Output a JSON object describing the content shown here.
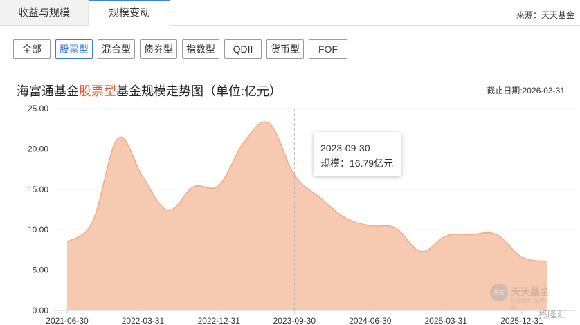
{
  "tabs": [
    {
      "label": "收益与规模"
    },
    {
      "label": "规模变动"
    }
  ],
  "source": "来源：天天基金",
  "filters": [
    "全部",
    "股票型",
    "混合型",
    "债券型",
    "指数型",
    "QDII",
    "货币型",
    "FOF"
  ],
  "active_filter": "股票型",
  "title_prefix": "海富通基金",
  "title_highlight": "股票型",
  "title_suffix": "基金规模走势图（单位:亿元）",
  "as_of": "截止日期:2026-03-31",
  "tooltip": {
    "date": "2023-09-30",
    "value_line": "规模：16.79亿元"
  },
  "watermark": {
    "badge": "基金",
    "name": "天天基金",
    "sub": "财富管理 · 值得信赖",
    "corner": "格隆汇"
  },
  "colors": {
    "fill": "#f5c6ad",
    "stroke": "#f1aa85",
    "accent": "#e8552a",
    "active_filter": "#3a7bd5"
  },
  "chart_data": {
    "type": "area",
    "title": "海富通基金股票型基金规模走势图（单位:亿元）",
    "ylabel": "",
    "xlabel": "",
    "ylim": [
      0,
      25
    ],
    "yticks": [
      "0.00",
      "5.00",
      "10.00",
      "15.00",
      "20.00",
      "25.00"
    ],
    "xtick_labels": [
      "2021-06-30",
      "2022-03-31",
      "2022-12-31",
      "2023-09-30",
      "2024-06-30",
      "2025-03-31",
      "2025-12-31"
    ],
    "x": [
      "2021-06-30",
      "2021-09-30",
      "2021-12-31",
      "2022-03-31",
      "2022-06-30",
      "2022-09-30",
      "2022-12-31",
      "2023-03-31",
      "2023-06-30",
      "2023-09-30",
      "2023-12-31",
      "2024-03-31",
      "2024-06-30",
      "2024-09-30",
      "2024-12-31",
      "2025-03-31",
      "2025-06-30",
      "2025-09-30",
      "2025-12-31",
      "2026-03-31"
    ],
    "values": [
      8.5,
      11.0,
      21.3,
      16.5,
      12.4,
      15.3,
      15.5,
      20.8,
      23.2,
      16.79,
      14.0,
      11.5,
      10.5,
      10.2,
      7.3,
      9.2,
      9.4,
      9.4,
      6.6,
      6.1
    ],
    "highlight_x": "2023-09-30",
    "grid": true,
    "legend": "none"
  }
}
